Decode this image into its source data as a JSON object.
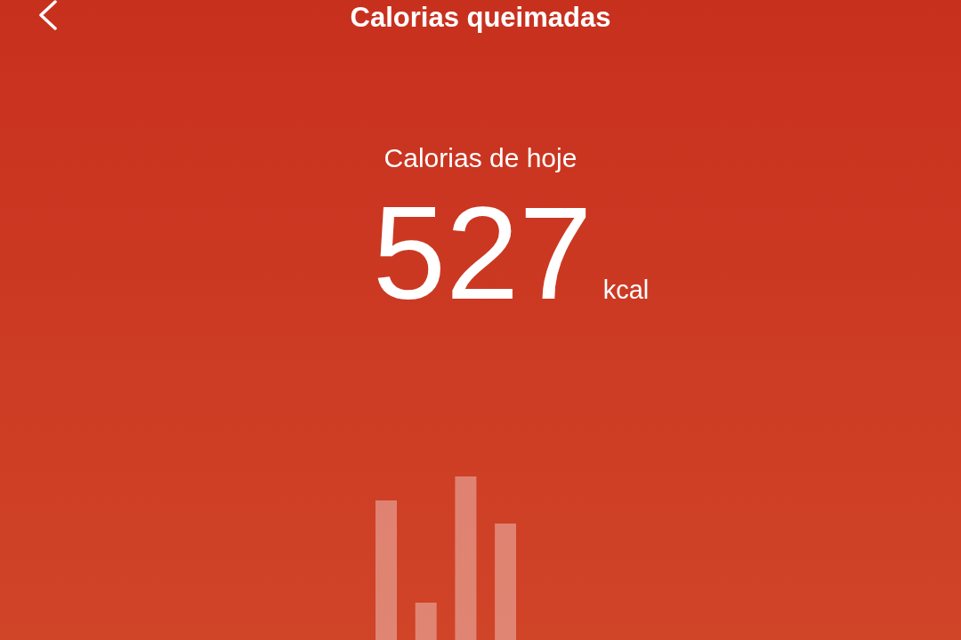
{
  "header": {
    "title": "Calorias queimadas"
  },
  "summary": {
    "label": "Calorias de hoje",
    "value": "527",
    "unit": "kcal"
  }
}
